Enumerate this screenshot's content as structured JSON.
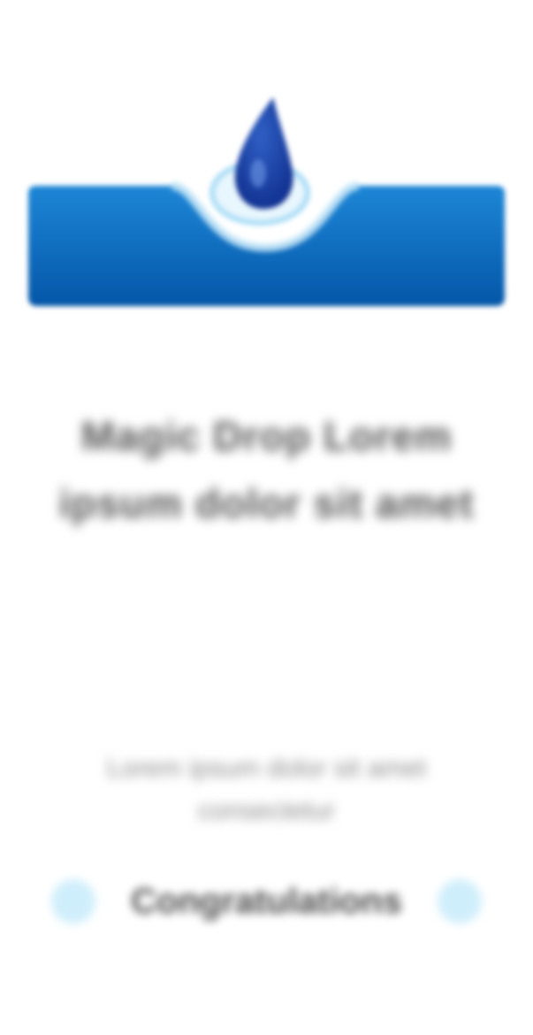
{
  "brand": {
    "logo_icon": "wave-droplet-logo-icon",
    "colors": {
      "primary": "#0a6fc2",
      "primary_dark": "#0456a8",
      "accent_light": "#bfe4f8",
      "drop_blue": "#1a4fb0"
    }
  },
  "headline": "Magic Drop Lorem ipsum dolor sit amet",
  "subtext": "Lorem ipsum dolor sit amet consectetur",
  "badge": {
    "label": "Congratulations",
    "dot_icon": "sparkle-dot-icon",
    "color": "#cfeefb"
  }
}
